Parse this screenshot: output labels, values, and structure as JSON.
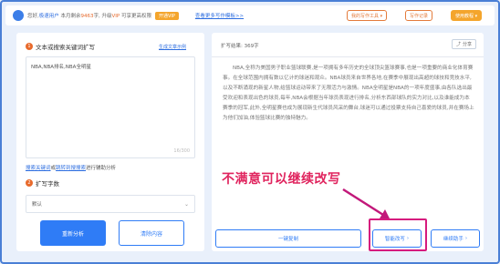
{
  "topbar": {
    "notice_prefix": "您好,",
    "notice_user": "极速用户",
    "notice_mid": " 本月剩余",
    "notice_count": "9463",
    "notice_mid2": "字, 升级",
    "notice_vip": "VIP",
    "notice_suffix": " 可享更高权限",
    "open_label": "开通VIP",
    "link_label": "查看更多写作模板>>",
    "pill1": "我的写作工具 ▾",
    "pill2": "写作记录",
    "pill3": "使用教程 ▾"
  },
  "left": {
    "section1_title": "文本或搜索关键词扩写",
    "badge1": "1",
    "example_link": "生成文章示例",
    "input_value": "NBA,NBA排名,NBA全明星",
    "counter": "16/300",
    "aux_prefix": "",
    "aux_link1": "搜索关键词",
    "aux_mid": "或",
    "aux_link2": "跳转到搜搜索",
    "aux_suffix": "进行辅助分析",
    "section2_title": "扩写字数",
    "badge2": "2",
    "select_value": "默认",
    "analyze_btn": "重新分析",
    "clear_btn": "清除内容"
  },
  "right": {
    "result_label": "扩写结果: 369字",
    "share_label": "分享",
    "paragraph": "NBA,全称为美国男子职业篮球联赛,是一项拥有多年历史的全球顶尖篮球赛事,也是一项重要的商业化体育赛事。在全球范围内拥有数以亿计的球迷和观众。NBA球员来自世界各地,在赛季中展现出高超的球技和竞技水平,以及不断涌现的新星人物,给篮球运动带来了无限活力与激情。NBA全明星是NBA的一项年度盛事,由各队选出最受欢迎和表现出色的球员,每年,NBA会根据当年球员表现进行排名,分析东西部球队的实力对比,以及谁能成为本赛季的冠军,此外,全明星赛也成为展现新生代球员风采的舞台,球迷可以通过投票支持自己喜爱的球员,并在赛场上为他们加油,体验篮球比赛的独特魅力。",
    "annotation": "不满意可以继续改写",
    "btn_polish": "一键复制",
    "btn_rewrite": "智能改写",
    "btn_continue": "继续助手"
  },
  "colors": {
    "accent": "#2f7cf6",
    "annotation": "#e0245e",
    "warning": "#f4a52c"
  }
}
